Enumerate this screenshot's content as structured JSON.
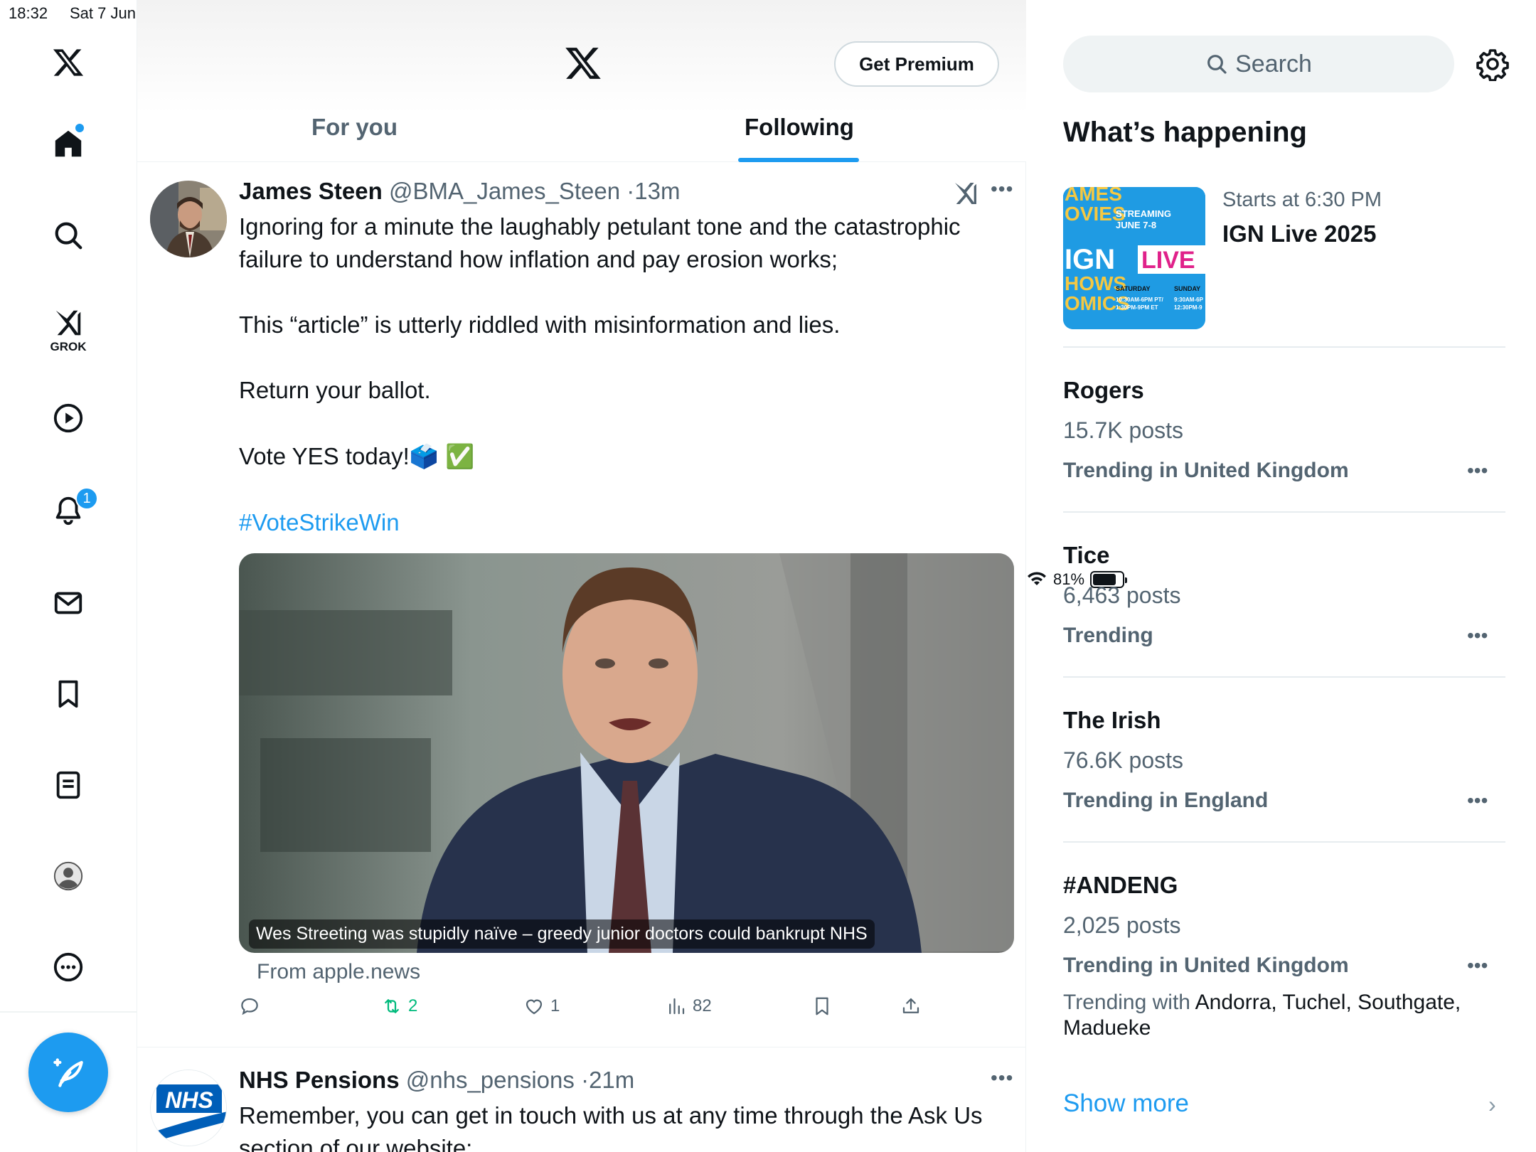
{
  "status": {
    "time": "18:32",
    "date": "Sat 7 Jun",
    "battery": "81%",
    "battery_level": 0.81
  },
  "nav": {
    "grok_label": "GROK",
    "notifications_badge": "1",
    "items": [
      "x-logo",
      "home-icon",
      "search-icon",
      "grok-icon",
      "video-icon",
      "notifications-icon",
      "messages-icon",
      "bookmarks-icon",
      "lists-icon",
      "profile-icon",
      "more-icon"
    ]
  },
  "header": {
    "premium_label": "Get Premium",
    "tabs": [
      "For you",
      "Following"
    ],
    "active_tab": "Following"
  },
  "post1": {
    "name": "James Steen",
    "handle": "@BMA_James_Steen",
    "time": "13m",
    "lines": [
      "Ignoring for a minute the laughably petulant tone and the catastrophic failure to understand how inflation and pay erosion works;",
      "This “article” is utterly riddled with misinformation and lies.",
      "Return your ballot.",
      "Vote YES today!"
    ],
    "emoji": "🗳️ ✅",
    "hashtag": "#VoteStrikeWin",
    "media_caption": "Wes Streeting was stupidly naïve – greedy junior doctors could bankrupt NHS",
    "source": "From apple.news",
    "reposts": "2",
    "likes": "1",
    "views": "82"
  },
  "post2": {
    "name": "NHS Pensions",
    "handle": "@nhs_pensions",
    "time": "21m",
    "logo_text": "NHS",
    "text": "Remember, you can get in touch with us at any time through the Ask Us section of our website:"
  },
  "sidebar": {
    "search_placeholder": "Search",
    "heading": "What’s happening",
    "event": {
      "subtitle": "Starts at 6:30 PM",
      "title": "IGN Live 2025",
      "image_text": [
        "AMES",
        "OVIES",
        "STREAMING",
        "JUNE 7-8",
        "IGN",
        "LIVE",
        "HOWS",
        "OMICS",
        "SATURDAY",
        "SUNDAY",
        "10:30AM-6PM PT/",
        "1:30PM-9PM ET",
        "9:30AM-6P",
        "12:30PM-9"
      ]
    },
    "trends": [
      {
        "title": "Rogers",
        "count": "15.7K posts",
        "context": "Trending in United Kingdom"
      },
      {
        "title": "Tice",
        "count": "6,463 posts",
        "context": "Trending"
      },
      {
        "title": "The Irish",
        "count": "76.6K posts",
        "context": "Trending in England"
      },
      {
        "title": "#ANDENG",
        "count": "2,025 posts",
        "context": "Trending in United Kingdom",
        "with_label": "Trending with",
        "with_names": "Andorra, Tuchel, Southgate, Madueke"
      }
    ],
    "show_more": "Show more"
  },
  "colors": {
    "accent": "#1d9bf0",
    "text": "#0f1419",
    "muted": "#536471",
    "repost": "#00ba7c"
  }
}
